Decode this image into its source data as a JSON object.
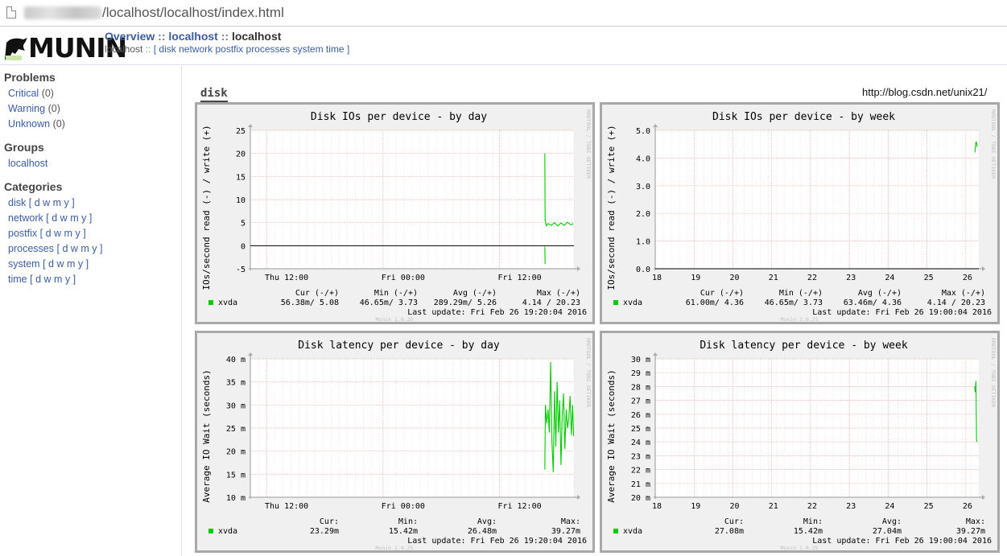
{
  "browser": {
    "url_path": "/localhost/localhost/index.html"
  },
  "header": {
    "logo_text": "MUNIN",
    "breadcrumb": {
      "overview": "Overview",
      "sep1": "::",
      "group": "localhost",
      "sep2": "::",
      "host": "localhost"
    },
    "subnav": {
      "host": "localhost",
      "sep": "::",
      "open": "[",
      "links": [
        "disk",
        "network",
        "postfix",
        "processes",
        "system",
        "time"
      ],
      "close": "]"
    }
  },
  "sidebar": {
    "problems_title": "Problems",
    "problems": [
      {
        "label": "Critical",
        "count": "(0)"
      },
      {
        "label": "Warning",
        "count": "(0)"
      },
      {
        "label": "Unknown",
        "count": "(0)"
      }
    ],
    "groups_title": "Groups",
    "groups": [
      "localhost"
    ],
    "categories_title": "Categories",
    "categories": [
      {
        "label": "disk",
        "links": [
          "d",
          "w",
          "m",
          "y"
        ]
      },
      {
        "label": "network",
        "links": [
          "d",
          "w",
          "m",
          "y"
        ]
      },
      {
        "label": "postfix",
        "links": [
          "d",
          "w",
          "m",
          "y"
        ]
      },
      {
        "label": "processes",
        "links": [
          "d",
          "w",
          "m",
          "y"
        ]
      },
      {
        "label": "system",
        "links": [
          "d",
          "w",
          "m",
          "y"
        ]
      },
      {
        "label": "time",
        "links": [
          "d",
          "w",
          "m",
          "y"
        ]
      }
    ]
  },
  "main": {
    "section_title": "disk",
    "watermark": "http://blog.csdn.net/unix21/"
  },
  "colors": {
    "link": "#3b5ba8",
    "series_green": "#00cc00",
    "grid_red": "#f0c0c0",
    "frame": "#a8a8a8"
  },
  "graphs": [
    {
      "title": "Disk IOs per device - by day",
      "ylabel": "IOs/second read (-) / write (+)",
      "yticks": [
        "25",
        "20",
        "15",
        "10",
        "5",
        "0",
        "-5"
      ],
      "yrange": [
        -5,
        25
      ],
      "xticks": [
        {
          "label": "Thu 12:00",
          "pos": 0.05
        },
        {
          "label": "Fri 00:00",
          "pos": 0.41
        },
        {
          "label": "Fri 12:00",
          "pos": 0.77
        }
      ],
      "side_text": "RRDTOOL / TOBI OETIKER",
      "legend_head": [
        "Cur (-/+)",
        "Min (-/+)",
        "Avg (-/+)",
        "Max (-/+)"
      ],
      "series": "xvda",
      "legend_vals": [
        "56.38m/  5.08",
        "46.65m/  3.73",
        "289.29m/  5.26",
        "4.14 / 20.23"
      ],
      "last_update": "Last update: Fri Feb 26 19:20:04 2016",
      "footer": "Munin 2.0.25",
      "zero_line": true,
      "trace": [
        [
          0.91,
          20.0
        ],
        [
          0.911,
          5.5
        ],
        [
          0.915,
          4.3
        ],
        [
          0.92,
          4.8
        ],
        [
          0.93,
          4.4
        ],
        [
          0.94,
          5.0
        ],
        [
          0.95,
          4.3
        ],
        [
          0.96,
          4.9
        ],
        [
          0.97,
          4.4
        ],
        [
          0.98,
          5.1
        ],
        [
          0.99,
          4.5
        ],
        [
          0.998,
          4.8
        ]
      ],
      "neg_trace": [
        [
          0.91,
          -0.2
        ],
        [
          0.911,
          -4.0
        ]
      ]
    },
    {
      "title": "Disk IOs per device - by week",
      "ylabel": "IOs/second read (-) / write (+)",
      "yticks": [
        "5.0",
        "4.0",
        "3.0",
        "2.0",
        "1.0",
        "0.0"
      ],
      "yrange": [
        0,
        5
      ],
      "xticks": [
        {
          "label": "18",
          "pos": 0.0
        },
        {
          "label": "19",
          "pos": 0.12
        },
        {
          "label": "20",
          "pos": 0.24
        },
        {
          "label": "21",
          "pos": 0.36
        },
        {
          "label": "22",
          "pos": 0.48
        },
        {
          "label": "23",
          "pos": 0.6
        },
        {
          "label": "24",
          "pos": 0.72
        },
        {
          "label": "25",
          "pos": 0.84
        },
        {
          "label": "26",
          "pos": 0.96
        }
      ],
      "side_text": "RRDTOOL / TOBI OETIKER",
      "legend_head": [
        "Cur (-/+)",
        "Min (-/+)",
        "Avg (-/+)",
        "Max (-/+)"
      ],
      "series": "xvda",
      "legend_vals": [
        "61.00m/  4.36",
        "46.65m/  3.73",
        "63.46m/  4.36",
        "4.14 / 20.23"
      ],
      "last_update": "Last update: Fri Feb 26 19:00:04 2016",
      "footer": "Munin 2.0.25",
      "zero_line": true,
      "trace": [
        [
          0.988,
          4.2
        ],
        [
          0.99,
          4.5
        ],
        [
          0.992,
          4.6
        ],
        [
          0.995,
          4.4
        ]
      ],
      "neg_trace": []
    },
    {
      "title": "Disk latency per device - by day",
      "ylabel": "Average IO Wait (seconds)",
      "yticks": [
        "40 m",
        "35 m",
        "30 m",
        "25 m",
        "20 m",
        "15 m",
        "10 m"
      ],
      "yrange": [
        10,
        40
      ],
      "xticks": [
        {
          "label": "Thu 12:00",
          "pos": 0.05
        },
        {
          "label": "Fri 00:00",
          "pos": 0.41
        },
        {
          "label": "Fri 12:00",
          "pos": 0.77
        }
      ],
      "side_text": "RRDTOOL / TOBI OETIKER",
      "legend_head": [
        "Cur:",
        "Min:",
        "Avg:",
        "Max:"
      ],
      "series": "xvda",
      "legend_vals": [
        "23.29m",
        "15.42m",
        "26.48m",
        "39.27m"
      ],
      "last_update": "Last update: Fri Feb 26 19:20:04 2016",
      "footer": "Munin 2.0.25",
      "zero_line": false,
      "trace": [
        [
          0.91,
          16.0
        ],
        [
          0.912,
          30.0
        ],
        [
          0.916,
          26.0
        ],
        [
          0.92,
          29.0
        ],
        [
          0.924,
          24.0
        ],
        [
          0.928,
          39.3
        ],
        [
          0.932,
          22.0
        ],
        [
          0.936,
          15.4
        ],
        [
          0.94,
          33.0
        ],
        [
          0.944,
          21.0
        ],
        [
          0.948,
          35.0
        ],
        [
          0.952,
          24.0
        ],
        [
          0.956,
          31.0
        ],
        [
          0.96,
          17.0
        ],
        [
          0.964,
          28.0
        ],
        [
          0.968,
          32.5
        ],
        [
          0.972,
          20.5
        ],
        [
          0.976,
          29.0
        ],
        [
          0.98,
          25.0
        ],
        [
          0.984,
          27.0
        ],
        [
          0.988,
          32.0
        ],
        [
          0.992,
          23.5
        ],
        [
          0.996,
          30.0
        ],
        [
          0.999,
          23.3
        ]
      ],
      "neg_trace": []
    },
    {
      "title": "Disk latency per device - by week",
      "ylabel": "Average IO Wait (seconds)",
      "yticks": [
        "30 m",
        "29 m",
        "28 m",
        "27 m",
        "26 m",
        "25 m",
        "24 m",
        "23 m",
        "22 m",
        "21 m",
        "20 m"
      ],
      "yrange": [
        20,
        30
      ],
      "xticks": [
        {
          "label": "18",
          "pos": 0.0
        },
        {
          "label": "19",
          "pos": 0.12
        },
        {
          "label": "20",
          "pos": 0.24
        },
        {
          "label": "21",
          "pos": 0.36
        },
        {
          "label": "22",
          "pos": 0.48
        },
        {
          "label": "23",
          "pos": 0.6
        },
        {
          "label": "24",
          "pos": 0.72
        },
        {
          "label": "25",
          "pos": 0.84
        },
        {
          "label": "26",
          "pos": 0.96
        }
      ],
      "side_text": "RRDTOOL / TOBI OETIKER",
      "legend_head": [
        "Cur:",
        "Min:",
        "Avg:",
        "Max:"
      ],
      "series": "xvda",
      "legend_vals": [
        "27.08m",
        "15.42m",
        "27.04m",
        "39.27m"
      ],
      "last_update": "Last update: Fri Feb 26 19:00:04 2016",
      "footer": "Munin 2.0.25",
      "zero_line": false,
      "trace": [
        [
          0.987,
          28.0
        ],
        [
          0.989,
          27.6
        ],
        [
          0.991,
          28.4
        ],
        [
          0.993,
          24.1
        ],
        [
          0.995,
          24.0
        ]
      ],
      "neg_trace": []
    }
  ],
  "chart_data": [
    {
      "type": "line",
      "title": "Disk IOs per device - by day",
      "ylabel": "IOs/second read (-) / write (+)",
      "ylim": [
        -5,
        25
      ],
      "x": [
        "Thu 12:00",
        "Fri 00:00",
        "Fri 12:00"
      ],
      "series": [
        {
          "name": "xvda",
          "cur": "56.38m/ 5.08",
          "min": "46.65m/ 3.73",
          "avg": "289.29m/ 5.26",
          "max": "4.14 / 20.23"
        }
      ]
    },
    {
      "type": "line",
      "title": "Disk IOs per device - by week",
      "ylabel": "IOs/second read (-) / write (+)",
      "ylim": [
        0,
        5
      ],
      "x": [
        "18",
        "19",
        "20",
        "21",
        "22",
        "23",
        "24",
        "25",
        "26"
      ],
      "series": [
        {
          "name": "xvda",
          "cur": "61.00m/ 4.36",
          "min": "46.65m/ 3.73",
          "avg": "63.46m/ 4.36",
          "max": "4.14 / 20.23"
        }
      ]
    },
    {
      "type": "line",
      "title": "Disk latency per device - by day",
      "ylabel": "Average IO Wait (seconds)",
      "ylim": [
        10,
        40
      ],
      "x": [
        "Thu 12:00",
        "Fri 00:00",
        "Fri 12:00"
      ],
      "series": [
        {
          "name": "xvda",
          "cur": "23.29m",
          "min": "15.42m",
          "avg": "26.48m",
          "max": "39.27m"
        }
      ]
    },
    {
      "type": "line",
      "title": "Disk latency per device - by week",
      "ylabel": "Average IO Wait (seconds)",
      "ylim": [
        20,
        30
      ],
      "x": [
        "18",
        "19",
        "20",
        "21",
        "22",
        "23",
        "24",
        "25",
        "26"
      ],
      "series": [
        {
          "name": "xvda",
          "cur": "27.08m",
          "min": "15.42m",
          "avg": "27.04m",
          "max": "39.27m"
        }
      ]
    }
  ]
}
